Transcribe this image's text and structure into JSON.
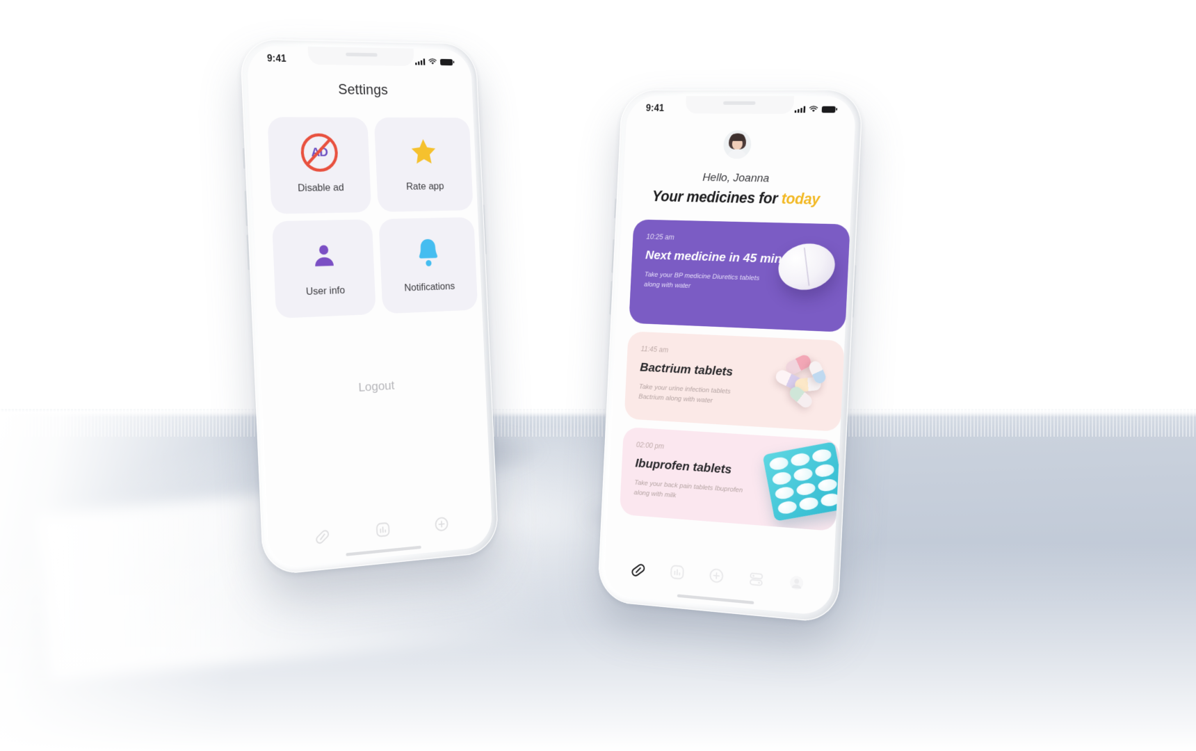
{
  "scene": {
    "background": "#ffffff",
    "floor_color": "#c3ccd9"
  },
  "phone_left": {
    "device": "iphone-mockup",
    "status_bar": {
      "time": "9:41",
      "signal_icon": "cellular-bars-icon",
      "wifi_icon": "wifi-icon",
      "battery_icon": "battery-full-icon"
    },
    "screen_title": "Settings",
    "tiles": [
      {
        "label": "Disable ad",
        "icon": "no-ads-icon",
        "icon_color": "#e8513f",
        "accent": "#6b4fc0"
      },
      {
        "label": "Rate app",
        "icon": "star-icon",
        "icon_color": "#f5c12e",
        "accent": "#f5c12e"
      },
      {
        "label": "User info",
        "icon": "user-person-icon",
        "icon_color": "#7b4fc4",
        "accent": "#7b4fc4"
      },
      {
        "label": "Notifications",
        "icon": "bell-icon",
        "icon_color": "#45bdf0",
        "accent": "#45bdf0"
      }
    ],
    "logout_label": "Logout",
    "nav_items": [
      {
        "icon": "pill-capsule-icon",
        "active": false
      },
      {
        "icon": "chart-card-icon",
        "active": false
      },
      {
        "icon": "plus-circle-icon",
        "active": false
      }
    ],
    "ad_icon_text": "AD"
  },
  "phone_right": {
    "device": "iphone-mockup",
    "status_bar": {
      "time": "9:41",
      "signal_icon": "cellular-bars-icon",
      "wifi_icon": "wifi-icon",
      "battery_icon": "battery-full-icon"
    },
    "avatar": "user-avatar-photo",
    "greeting": "Hello, Joanna",
    "headline_prefix": "Your medicines for ",
    "headline_accent": "today",
    "headline_accent_color": "#f2b822",
    "cards": [
      {
        "time": "10:25 am",
        "title": "Next medicine in 45 mins",
        "description": "Take your BP medicine Diuretics tablets along with water",
        "background": "#7b5cc4",
        "art": "white-tablet-icon"
      },
      {
        "time": "11:45 am",
        "title": "Bactrium tablets",
        "description": "Take your urine infection tablets Bactrium along with water",
        "background": "#fbe9e7",
        "art": "capsules-cluster-icon"
      },
      {
        "time": "02:00 pm",
        "title": "Ibuprofen tablets",
        "description": "Take your back pain tablets Ibuprofen along with milk",
        "background": "#fbe7ef",
        "art": "blister-pack-icon"
      }
    ],
    "nav_items": [
      {
        "icon": "pill-capsule-icon",
        "active": true
      },
      {
        "icon": "chart-card-icon",
        "active": false
      },
      {
        "icon": "plus-circle-icon",
        "active": false
      },
      {
        "icon": "toggles-settings-icon",
        "active": false
      },
      {
        "icon": "profile-avatar-icon",
        "active": false
      }
    ]
  }
}
